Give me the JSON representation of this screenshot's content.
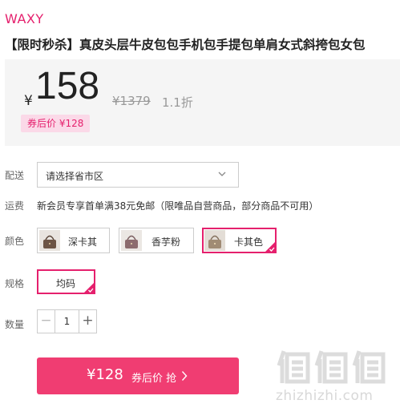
{
  "brand": "WAXY",
  "product_title": "【限时秒杀】真皮头层牛皮包包手机包手提包单肩女式斜挎包女包",
  "price": {
    "currency": "¥",
    "current": "158",
    "original": "¥1379",
    "discount": "1.1折",
    "coupon_price": "券后价 ¥128"
  },
  "delivery": {
    "label": "配送",
    "placeholder": "请选择省市区"
  },
  "freight": {
    "label": "运费",
    "text": "新会员专享首单满38元免邮（限唯品自营商品，部分商品不可用）"
  },
  "colors": {
    "label": "颜色",
    "options": [
      {
        "name": "深卡其",
        "selected": false
      },
      {
        "name": "香芋粉",
        "selected": false
      },
      {
        "name": "卡其色",
        "selected": true
      }
    ]
  },
  "sizes": {
    "label": "规格",
    "options": [
      {
        "name": "均码",
        "selected": true
      }
    ]
  },
  "quantity": {
    "label": "数量",
    "value": "1",
    "minus": "−",
    "plus": "+"
  },
  "buy_button": {
    "price": "¥128",
    "label": "券后价 抢"
  },
  "watermark": {
    "text": "zhizhizhi.com"
  },
  "theme": {
    "accent": "#e5206d",
    "button": "#f03d72"
  }
}
